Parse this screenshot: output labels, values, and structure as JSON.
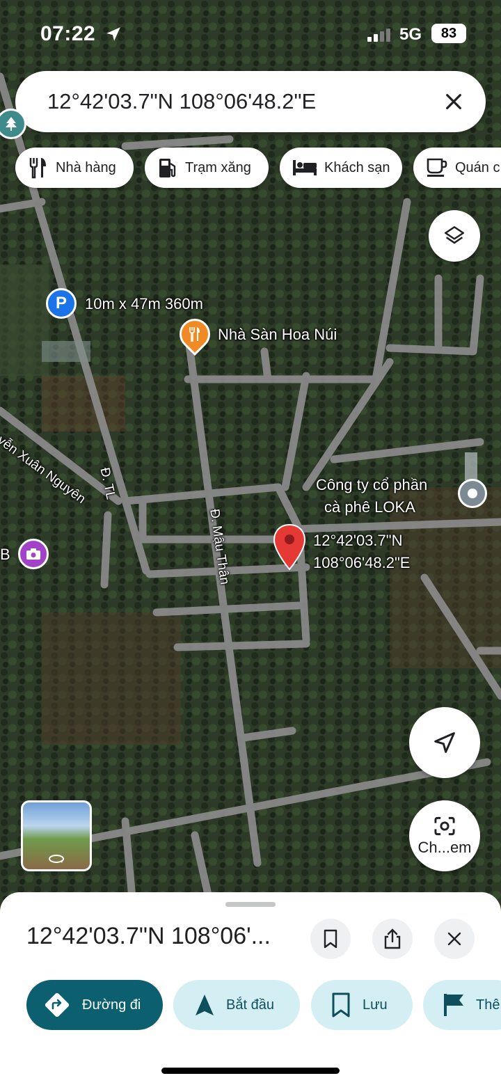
{
  "status_bar": {
    "time": "07:22",
    "network": "5G",
    "battery": "83"
  },
  "search": {
    "query": "12°42'03.7\"N 108°06'48.2\"E"
  },
  "chips": [
    {
      "label": "Nhà hàng",
      "icon": "fork-knife-icon"
    },
    {
      "label": "Trạm xăng",
      "icon": "gas-station-icon"
    },
    {
      "label": "Khách sạn",
      "icon": "bed-icon"
    },
    {
      "label": "Quán c",
      "icon": "coffee-cup-icon"
    }
  ],
  "map": {
    "labels": {
      "parking": "10m x 47m 360m",
      "restaurant": "Nhà Sàn Hoa Núi",
      "company_line1": "Công ty cổ phần",
      "company_line2": "cà phê LOKA",
      "pin_lat": "12°42'03.7\"N",
      "pin_lon": "108°06'48.2\"E",
      "street_tl": "Đ. TL",
      "street_nguyen": "uyễn Xuân Nguyên",
      "street_mau_than": "Đ. Mậu Thân",
      "partial_b": "B"
    },
    "camera_button_label": "Ch...em"
  },
  "sheet": {
    "title": "12°42'03.7\"N 108°06'...",
    "actions": [
      {
        "label": "Đường đi",
        "icon": "directions-icon"
      },
      {
        "label": "Bắt đầu",
        "icon": "navigation-arrow-icon"
      },
      {
        "label": "Lưu",
        "icon": "bookmark-icon"
      },
      {
        "label": "Thê",
        "icon": "flag-icon"
      }
    ]
  },
  "colors": {
    "primary_teal": "#0b5f6e",
    "secondary_teal": "#d4eff4",
    "pin_red": "#e53935",
    "poi_orange": "#f08a24",
    "poi_blue": "#1a73e8",
    "poi_purple": "#a142c8"
  }
}
